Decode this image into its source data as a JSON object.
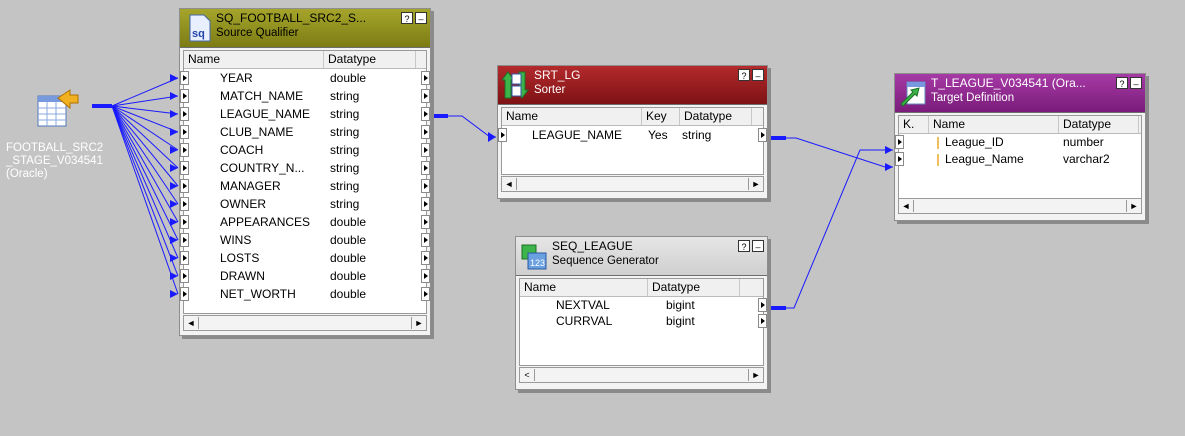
{
  "source": {
    "label": "FOOTBALL_SRC2_STAGE_V034541 (Oracle)",
    "icon": "database-table-arrow-icon"
  },
  "sq": {
    "name": "SQ_FOOTBALL_SRC2_S...",
    "type": "Source Qualifier",
    "icon_text": "sq",
    "help": "?",
    "minimize": "–",
    "headers": {
      "name": "Name",
      "datatype": "Datatype"
    },
    "rows": [
      {
        "name": "YEAR",
        "datatype": "double"
      },
      {
        "name": "MATCH_NAME",
        "datatype": "string"
      },
      {
        "name": "LEAGUE_NAME",
        "datatype": "string"
      },
      {
        "name": "CLUB_NAME",
        "datatype": "string"
      },
      {
        "name": "COACH",
        "datatype": "string"
      },
      {
        "name": "COUNTRY_N...",
        "datatype": "string"
      },
      {
        "name": "MANAGER",
        "datatype": "string"
      },
      {
        "name": "OWNER",
        "datatype": "string"
      },
      {
        "name": "APPEARANCES",
        "datatype": "double"
      },
      {
        "name": "WINS",
        "datatype": "double"
      },
      {
        "name": "LOSTS",
        "datatype": "double"
      },
      {
        "name": "DRAWN",
        "datatype": "double"
      },
      {
        "name": "NET_WORTH",
        "datatype": "double"
      }
    ],
    "scroll_left": "◄",
    "scroll_right": "►"
  },
  "srt": {
    "name": "SRT_LG",
    "type": "Sorter",
    "help": "?",
    "minimize": "–",
    "headers": {
      "name": "Name",
      "key": "Key",
      "datatype": "Datatype"
    },
    "rows": [
      {
        "name": "LEAGUE_NAME",
        "key": "Yes",
        "datatype": "string"
      }
    ],
    "scroll_left": "◄",
    "scroll_right": "►"
  },
  "seq": {
    "name": "SEQ_LEAGUE",
    "type": "Sequence Generator",
    "help": "?",
    "minimize": "–",
    "headers": {
      "name": "Name",
      "datatype": "Datatype"
    },
    "rows": [
      {
        "name": "NEXTVAL",
        "datatype": "bigint"
      },
      {
        "name": "CURRVAL",
        "datatype": "bigint"
      }
    ],
    "scroll_left": "<",
    "scroll_right": "►"
  },
  "tgt": {
    "name": "T_LEAGUE_V034541 (Ora...",
    "type": "Target Definition",
    "help": "?",
    "minimize": "–",
    "headers": {
      "key": "K.",
      "name": "Name",
      "datatype": "Datatype"
    },
    "rows": [
      {
        "name": "League_ID",
        "datatype": "number"
      },
      {
        "name": "League_Name",
        "datatype": "varchar2"
      }
    ],
    "scroll_left": "◄",
    "scroll_right": "►"
  },
  "colors": {
    "canvas": "#c4c4c4",
    "sq_header": "#8a8a1e",
    "srt_header": "#9a1e20",
    "seq_header": "#d8d8d8",
    "tgt_header": "#8e2b8e",
    "link": "#1a1aff"
  }
}
